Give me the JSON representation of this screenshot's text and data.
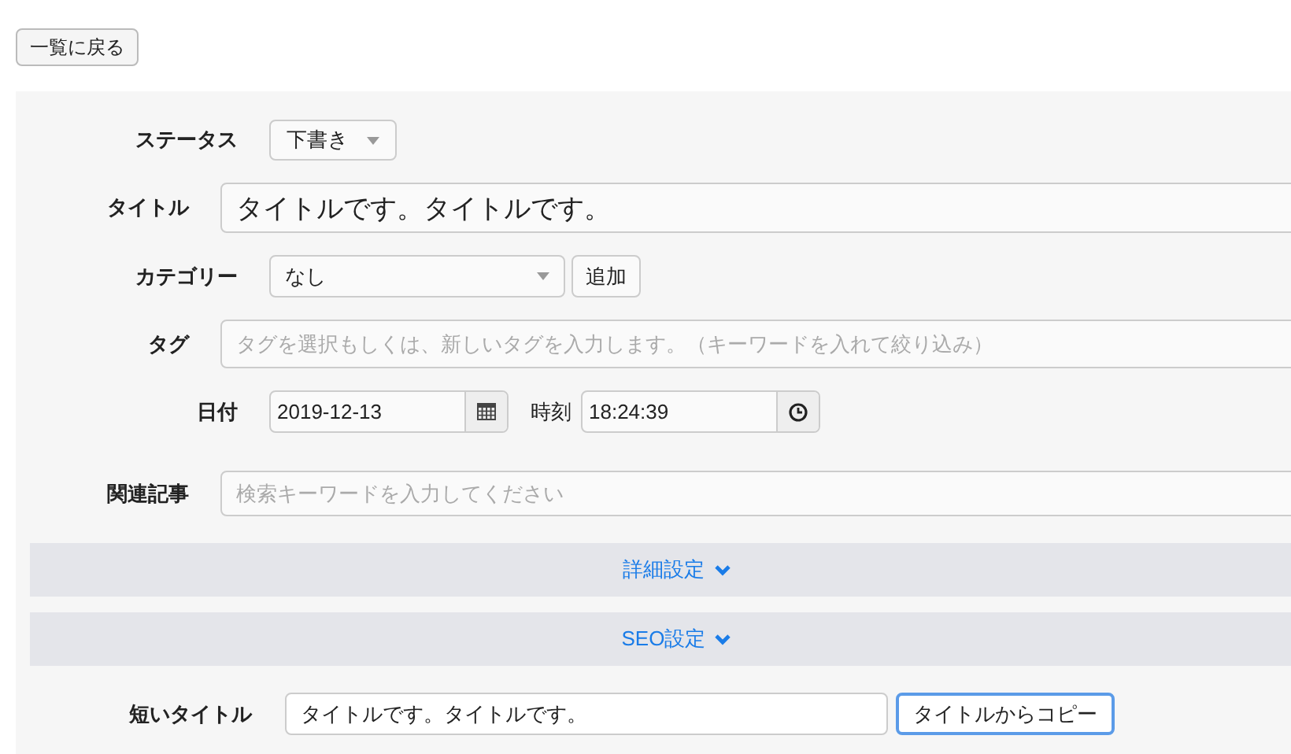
{
  "back_button": {
    "label": "一覧に戻る"
  },
  "fields": [
    {
      "kind": "select",
      "label": "ステータス",
      "value": "下書き"
    },
    {
      "kind": "title",
      "label": "タイトル",
      "value": "タイトルです。タイトルです。"
    },
    {
      "kind": "select_add",
      "label": "カテゴリー",
      "value": "なし",
      "button": "追加"
    },
    {
      "kind": "tags",
      "label": "タグ",
      "placeholder": "タグを選択もしくは、新しいタグを入力します。（キーワードを入れて絞り込み）"
    },
    {
      "kind": "datetime",
      "label": "日付",
      "value": "2019-12-13",
      "time_label": "時刻",
      "time_value": "18:24:39"
    },
    {
      "kind": "search",
      "label": "関連記事",
      "placeholder": "検索キーワードを入力してください"
    }
  ],
  "sections": [
    {
      "label": "詳細設定",
      "expanded": false
    },
    {
      "label": "SEO設定",
      "expanded": false
    }
  ],
  "short_title": {
    "label": "短いタイトル",
    "value": "タイトルです。タイトルです。",
    "button": "タイトルからコピー"
  }
}
